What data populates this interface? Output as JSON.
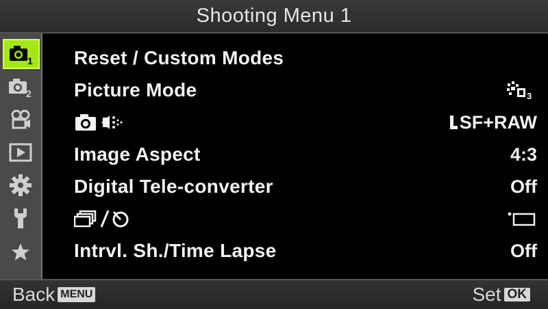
{
  "header": {
    "title": "Shooting Menu 1"
  },
  "sidebar": {
    "tabs": [
      {
        "icon": "camera-1-icon",
        "active": true
      },
      {
        "icon": "camera-2-icon",
        "active": false
      },
      {
        "icon": "movie-icon",
        "active": false
      },
      {
        "icon": "playback-icon",
        "active": false
      },
      {
        "icon": "gear-icon",
        "active": false
      },
      {
        "icon": "wrench-icon",
        "active": false
      },
      {
        "icon": "star-icon",
        "active": false
      }
    ],
    "active_color": "#a4e617"
  },
  "menu": {
    "items": [
      {
        "label": "Reset / Custom Modes",
        "value": ""
      },
      {
        "label": "Picture Mode",
        "value_icon": "picture-mode-3-icon"
      },
      {
        "label_icon": "camera-quality-icon",
        "value": "SF+RAW"
      },
      {
        "label": "Image Aspect",
        "value": "4:3"
      },
      {
        "label": "Digital Tele-converter",
        "value": "Off"
      },
      {
        "label_icon": "drive-selftimer-icon",
        "value_icon": "single-shot-icon"
      },
      {
        "label": "Intrvl. Sh./Time Lapse",
        "value": "Off"
      }
    ]
  },
  "footer": {
    "back_label": "Back",
    "back_key": "MENU",
    "set_label": "Set",
    "set_key": "OK"
  }
}
